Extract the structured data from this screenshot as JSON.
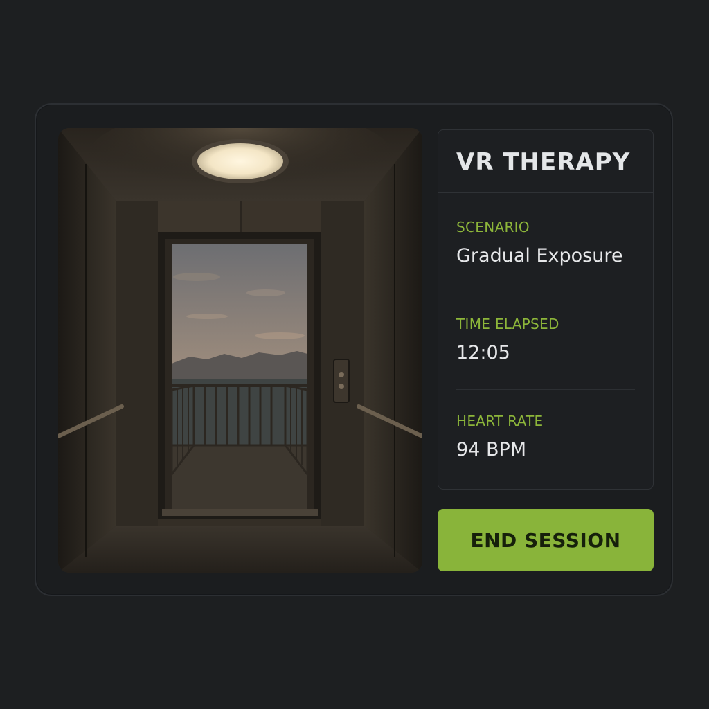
{
  "panel": {
    "title": "VR THERAPY",
    "stats": [
      {
        "label": "SCENARIO",
        "value": "Gradual Exposure"
      },
      {
        "label": "TIME ELAPSED",
        "value": "12:05"
      },
      {
        "label": "HEART RATE",
        "value": "94 BPM"
      }
    ]
  },
  "actions": {
    "end_session_label": "END SESSION"
  },
  "colors": {
    "accent": "#8db63a",
    "button_bg": "#89b43a",
    "page_bg": "#1d1f21",
    "panel_bg": "#1d1f22"
  }
}
